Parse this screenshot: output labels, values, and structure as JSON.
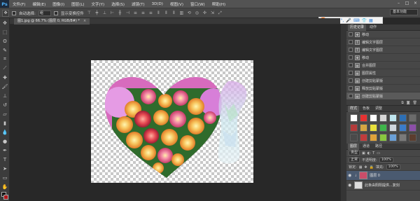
{
  "app": {
    "logo": "Ps"
  },
  "menu": [
    "文件(F)",
    "编辑(E)",
    "图像(I)",
    "图层(L)",
    "文字(Y)",
    "选择(S)",
    "滤镜(T)",
    "3D(D)",
    "视图(V)",
    "窗口(W)",
    "帮助(H)"
  ],
  "window_controls": [
    "–",
    "□",
    "×"
  ],
  "options": {
    "auto_select_label": "自动选择:",
    "auto_select_value": "组",
    "show_transform_label": "显示变换控件",
    "workspace": "基本功能"
  },
  "ime": {
    "mode": "中"
  },
  "document_tab": {
    "title": "图1.jpg @ 66.7% (图层 0, RGB/8#) *",
    "close": "×"
  },
  "history": {
    "tabs": [
      "历史记录",
      "动作"
    ],
    "items": [
      {
        "label": "移动"
      },
      {
        "label": "编辑文字图层"
      },
      {
        "label": "编辑文字图层"
      },
      {
        "label": "移动"
      },
      {
        "label": "合并图层"
      },
      {
        "label": "图层属性"
      },
      {
        "label": "创建剪贴蒙版"
      },
      {
        "label": "释放剪贴蒙版"
      },
      {
        "label": "创建剪贴蒙版"
      }
    ]
  },
  "styles_panel": {
    "tabs": [
      "样式",
      "色板",
      "调整"
    ],
    "swatches": [
      "#ffffff",
      "#e63232",
      "#ffffff",
      "#d7d7d7",
      "#bfe5ef",
      "#2d6fb5",
      "#6b6b6b",
      "#b33a3a",
      "#d6a642",
      "#e8e03b",
      "#3eb54a",
      "#cfd6dd",
      "#3b7cc9",
      "#8c4fa8",
      "#4a4a4a",
      "#c13c3c",
      "#e0a33a",
      "#89c83f",
      "#6aa0d8",
      "#7a7a7a",
      "#5c3d2e"
    ]
  },
  "layers": {
    "tabs": [
      "图层",
      "通道",
      "路径"
    ],
    "kind_label": "类型",
    "blend_mode": "正常",
    "opacity_label": "不透明度:",
    "opacity_value": "100%",
    "lock_label": "锁定:",
    "fill_label": "填充:",
    "fill_value": "100%",
    "items": [
      {
        "name": "图层 0",
        "selected": true
      },
      {
        "name": "此条由阳阳提供...复刻",
        "selected": false
      }
    ]
  }
}
